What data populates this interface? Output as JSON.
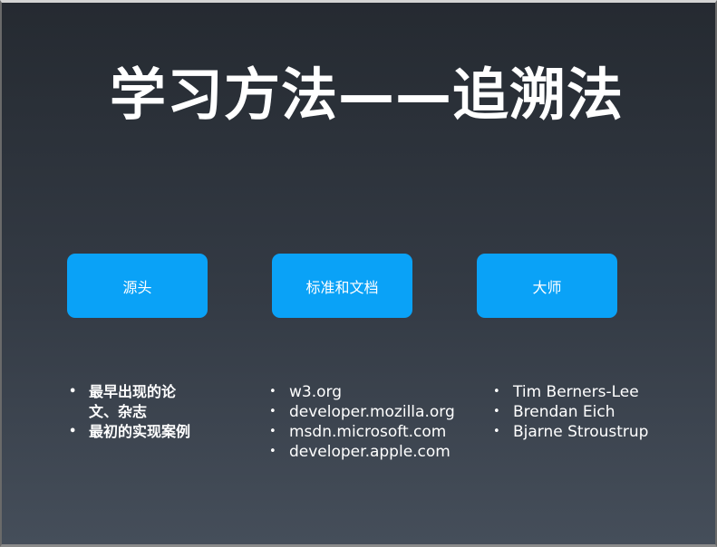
{
  "slide": {
    "title": "学习方法——追溯法",
    "boxes": [
      {
        "label": "源头"
      },
      {
        "label": "标准和文档"
      },
      {
        "label": "大师"
      }
    ],
    "lists": [
      {
        "items": [
          "最早出现的论文、杂志",
          "最初的实现案例"
        ]
      },
      {
        "items": [
          "w3.org",
          "developer.mozilla.org",
          "msdn.microsoft.com",
          "developer.apple.com"
        ]
      },
      {
        "items": [
          "Tim Berners-Lee",
          "Brendan Eich",
          "Bjarne Stroustrup"
        ]
      }
    ]
  },
  "colors": {
    "box_fill": "#0aa2f7",
    "background_top": "#252a31",
    "background_bottom": "#454e5a",
    "text": "#ffffff"
  }
}
